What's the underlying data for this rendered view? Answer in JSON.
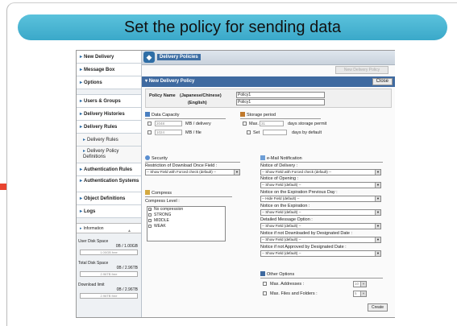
{
  "slide": {
    "title": "Set the policy for sending data"
  },
  "sidebar": {
    "items": [
      "New Delivery",
      "Message Box",
      "Options",
      "Users & Groups",
      "Delivery Histories",
      "Delivery Rules",
      "Delivery Rules",
      "Delivery Policy Definitions",
      "Authentication Rules",
      "Authentication Systems",
      "Object Definitions",
      "Logs"
    ],
    "information": "Information",
    "disks": [
      {
        "label": "User Disk Space",
        "value": "0B / 1.00GB",
        "free": "1.00GB free"
      },
      {
        "label": "Total Disk Space",
        "value": "0B / 2.96TB",
        "free": "2.96TB free"
      },
      {
        "label": "Download limit",
        "value": "0B / 2.96TB",
        "free": "2.96TB free"
      }
    ]
  },
  "header": {
    "title": "Delivery Policies",
    "new_policy_button": "New Delivery Policy",
    "subbar_title": "New Delivery Policy",
    "close_button": "Close"
  },
  "policy_name": {
    "label": "Policy Name",
    "japanese_label": "(Japanese/Chinese)",
    "english_label": "(English)",
    "japanese_value": "Policy1",
    "english_value": "Policy1"
  },
  "data_capacity": {
    "title": "Data Capacity",
    "per_delivery_value": "2048",
    "per_delivery_unit": "MB / delivery",
    "per_file_value": "1024",
    "per_file_unit": "MB / file"
  },
  "storage_period": {
    "title": "Storage period",
    "max_label": "Max.",
    "max_value": "31",
    "max_unit": "days storage permit",
    "set_label": "Set",
    "set_unit": "days by default"
  },
  "security": {
    "title": "Security",
    "restriction_label": "Restriction of Download Once Field :",
    "restriction_value": "-- Show Field with Forced check (default) --"
  },
  "compress": {
    "title": "Compress",
    "level_label": "Compress Level :",
    "options": [
      "No compression",
      "STRONG",
      "MIDDLE",
      "WEAK"
    ]
  },
  "email": {
    "title": "e-Mail Notification",
    "fields": [
      {
        "label": "Notice of Delivery :",
        "value": "-- Show Field with Forced check (default) --"
      },
      {
        "label": "Notice of Opening :",
        "value": "-- Show Field (default) --"
      },
      {
        "label": "Notice on the Expiration Previous Day :",
        "value": "-- Hide Field (default) --"
      },
      {
        "label": "Notice on the Expiration :",
        "value": "-- Show Field (default) --"
      },
      {
        "label": "Detailed Message Option :",
        "value": "-- Show Field (default) --"
      },
      {
        "label": "Notice if not Downloaded by Designated Date :",
        "value": "-- Show Field (default) --"
      },
      {
        "label": "Notice if not Approved by Designated Date :",
        "value": "-- Show Field (default) --"
      }
    ]
  },
  "other": {
    "title": "Other Options",
    "max_addresses_label": "Max. Addresses :",
    "max_addresses_value": "10",
    "max_files_label": "Max. Files and Folders :",
    "max_files_value": "5"
  },
  "create_button": "Create"
}
